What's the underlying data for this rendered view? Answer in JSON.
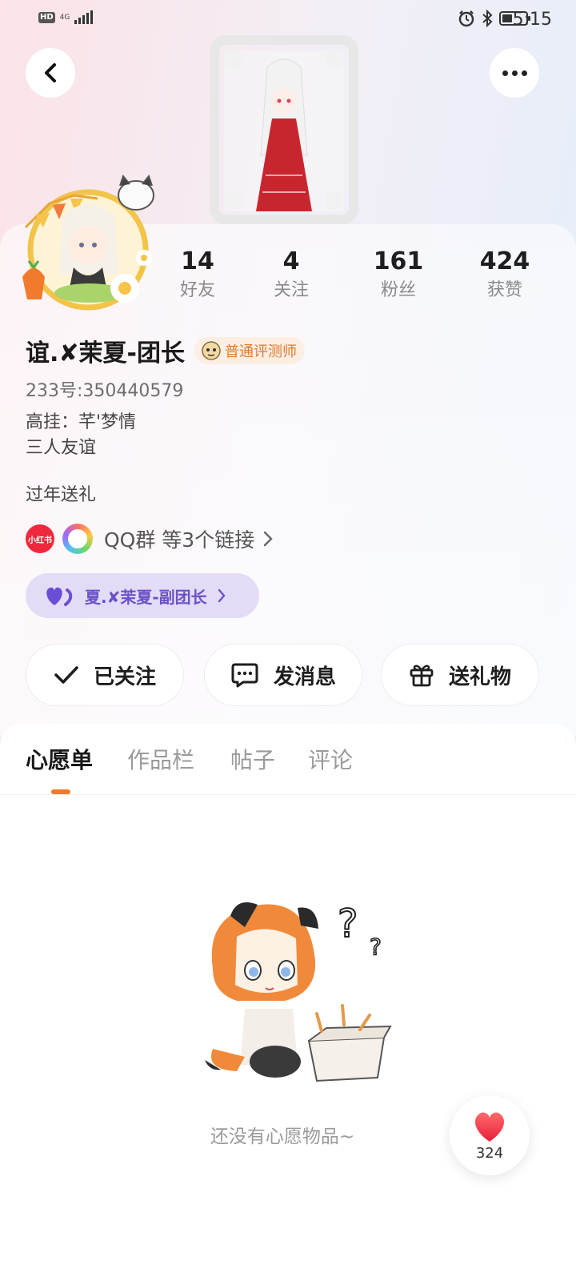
{
  "status_bar": {
    "hd": "HD",
    "network": "4G",
    "time": "5:15"
  },
  "profile": {
    "stats": [
      {
        "value": "14",
        "label": "好友"
      },
      {
        "value": "4",
        "label": "关注"
      },
      {
        "value": "161",
        "label": "粉丝"
      },
      {
        "value": "424",
        "label": "获赞"
      }
    ],
    "nickname": "谊.✘茉夏-团长",
    "badge": "普通评测师",
    "uid": "233号:350440579",
    "bio_lines": [
      "高挂：芊'梦情",
      "三人友谊"
    ],
    "gift_note": "过年送礼",
    "links": {
      "xhs_label": "小红书",
      "text": "QQ群 等3个链接"
    },
    "group_chip": "夏.✘茉夏-副团长"
  },
  "actions": {
    "follow": "已关注",
    "message": "发消息",
    "gift": "送礼物"
  },
  "tabs": [
    "心愿单",
    "作品栏",
    "帖子",
    "评论"
  ],
  "active_tab_index": 0,
  "empty_state": {
    "text": "还没有心愿物品~"
  },
  "like_fab": {
    "count": "324"
  },
  "colors": {
    "accent_orange": "#f07a28",
    "badge_text": "#e07a2e",
    "group_purple": "#6a52c8",
    "xhs_red": "#f0283c",
    "heart_red": "#ff3b4e"
  },
  "icons": {
    "back": "back-arrow-icon",
    "more": "more-dots-icon",
    "follow": "check-icon",
    "message": "chat-bubble-icon",
    "gift": "gift-icon",
    "link_chevron": "chevron-right-icon",
    "heart": "heart-icon"
  }
}
